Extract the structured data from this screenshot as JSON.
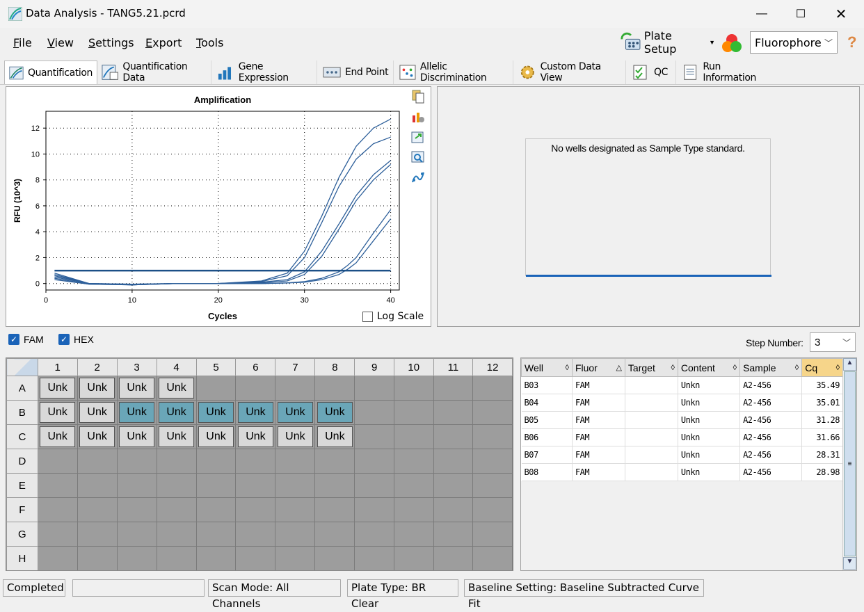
{
  "window": {
    "title": "Data Analysis - TANG5.21.pcrd"
  },
  "menu": {
    "file": "File",
    "view": "View",
    "settings": "Settings",
    "export": "Export",
    "tools": "Tools",
    "plate_setup": "Plate Setup",
    "fluorophore": "Fluorophore",
    "help": "?"
  },
  "tabs": [
    "Quantification",
    "Quantification Data",
    "Gene Expression",
    "End Point",
    "Allelic Discrimination",
    "Custom Data View",
    "QC",
    "Run Information"
  ],
  "chart_data": {
    "type": "line",
    "title": "Amplification",
    "xlabel": "Cycles",
    "ylabel": "RFU (10^3)",
    "xlim": [
      0,
      41
    ],
    "ylim": [
      -0.5,
      13.3
    ],
    "xticks": [
      0,
      10,
      20,
      30,
      40
    ],
    "yticks": [
      0,
      2,
      4,
      6,
      8,
      10,
      12
    ],
    "threshold": 1.0,
    "series": [
      {
        "x": [
          1,
          5,
          10,
          15,
          20,
          25,
          28,
          30,
          32,
          34,
          36,
          38,
          40
        ],
        "y": [
          0.6,
          0,
          -0.05,
          0,
          0,
          0.2,
          0.8,
          2.5,
          5.2,
          8.2,
          10.6,
          12.0,
          12.7
        ]
      },
      {
        "x": [
          1,
          5,
          10,
          15,
          20,
          25,
          28,
          30,
          32,
          34,
          36,
          38,
          40
        ],
        "y": [
          0.5,
          0,
          -0.05,
          0,
          0,
          0.15,
          0.6,
          2.0,
          4.7,
          7.5,
          9.6,
          10.8,
          11.3
        ]
      },
      {
        "x": [
          1,
          5,
          10,
          15,
          20,
          25,
          28,
          30,
          32,
          34,
          36,
          38,
          40
        ],
        "y": [
          0.8,
          0,
          -0.1,
          0,
          0,
          0.1,
          0.3,
          0.9,
          2.5,
          4.6,
          6.8,
          8.4,
          9.5
        ]
      },
      {
        "x": [
          1,
          5,
          10,
          15,
          20,
          25,
          28,
          30,
          32,
          34,
          36,
          38,
          40
        ],
        "y": [
          0.7,
          0,
          -0.1,
          0,
          0,
          0.05,
          0.2,
          0.7,
          2.1,
          4.2,
          6.4,
          8.0,
          9.2
        ]
      },
      {
        "x": [
          1,
          5,
          10,
          15,
          20,
          25,
          28,
          30,
          32,
          34,
          35,
          36,
          38,
          40
        ],
        "y": [
          0.4,
          -0.05,
          -0.1,
          0,
          0,
          0,
          0.05,
          0.15,
          0.4,
          0.9,
          1.4,
          2.0,
          3.9,
          5.7
        ]
      },
      {
        "x": [
          1,
          5,
          10,
          15,
          20,
          25,
          28,
          30,
          32,
          34,
          35,
          36,
          38,
          40
        ],
        "y": [
          0.3,
          -0.05,
          -0.1,
          0,
          0,
          0,
          0.05,
          0.1,
          0.3,
          0.7,
          1.1,
          1.6,
          3.3,
          5.0
        ]
      }
    ]
  },
  "chart": {
    "log_scale_label": "Log Scale"
  },
  "std_curve": {
    "message": "No wells designated as Sample Type standard."
  },
  "channels": {
    "fam": "FAM",
    "hex": "HEX",
    "step_label": "Step Number:",
    "step_value": "3"
  },
  "plate": {
    "cols": [
      "1",
      "2",
      "3",
      "4",
      "5",
      "6",
      "7",
      "8",
      "9",
      "10",
      "11",
      "12"
    ],
    "rows": [
      "A",
      "B",
      "C",
      "D",
      "E",
      "F",
      "G",
      "H"
    ],
    "filled": {
      "A": 4,
      "B": 8,
      "C": 8
    },
    "selected_b": [
      3,
      4,
      5,
      6,
      7,
      8
    ],
    "well_label": "Unk"
  },
  "results": {
    "headers": [
      "Well",
      "Fluor",
      "Target",
      "Content",
      "Sample",
      "Cq"
    ],
    "rows": [
      [
        "B03",
        "FAM",
        "",
        "Unkn",
        "A2-456",
        "35.49"
      ],
      [
        "B04",
        "FAM",
        "",
        "Unkn",
        "A2-456",
        "35.01"
      ],
      [
        "B05",
        "FAM",
        "",
        "Unkn",
        "A2-456",
        "31.28"
      ],
      [
        "B06",
        "FAM",
        "",
        "Unkn",
        "A2-456",
        "31.66"
      ],
      [
        "B07",
        "FAM",
        "",
        "Unkn",
        "A2-456",
        "28.31"
      ],
      [
        "B08",
        "FAM",
        "",
        "Unkn",
        "A2-456",
        "28.98"
      ]
    ]
  },
  "status": {
    "state": "Completed",
    "scan_mode": "Scan Mode: All Channels",
    "plate_type": "Plate Type: BR Clear",
    "baseline": "Baseline Setting: Baseline Subtracted Curve Fit"
  },
  "colors": {
    "accent": "#1a63b8",
    "selected_well": "#6aa6b8",
    "curve": "#2d5f9a"
  }
}
